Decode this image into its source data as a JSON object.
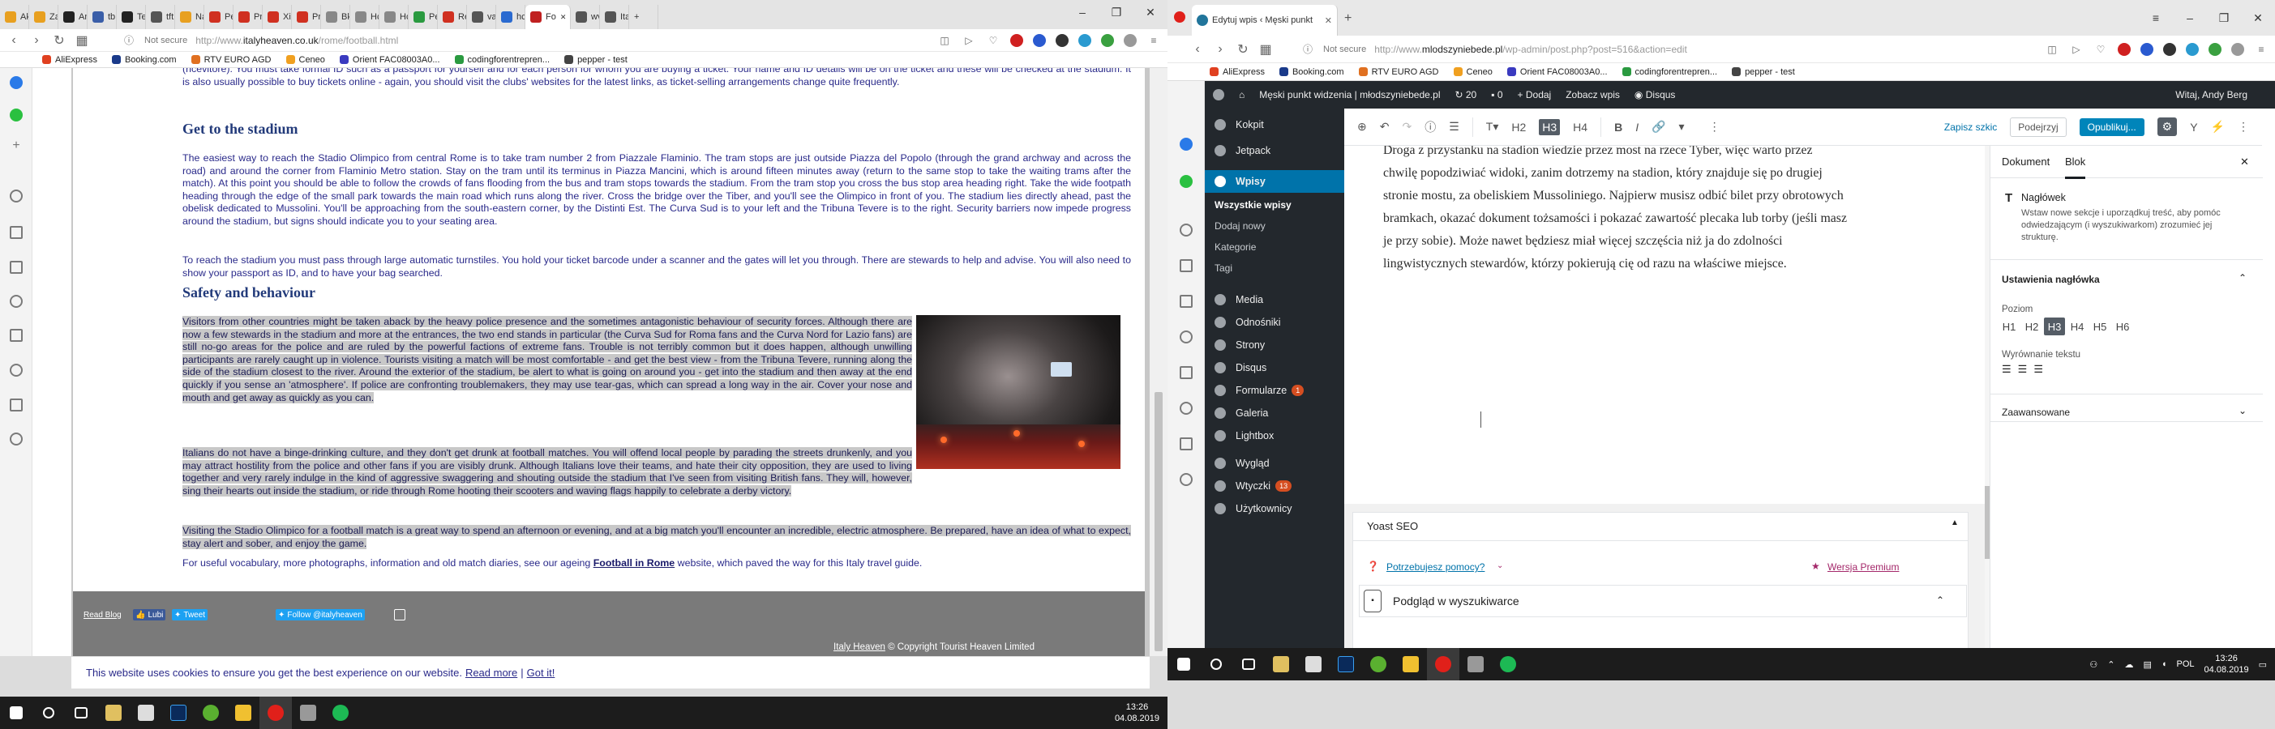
{
  "left_browser": {
    "tabs": [
      {
        "label": "Ak",
        "color": "#e8a020"
      },
      {
        "label": "Za",
        "color": "#e8a020"
      },
      {
        "label": "An",
        "color": "#222222"
      },
      {
        "label": "tb",
        "color": "#3a5ea8"
      },
      {
        "label": "Te",
        "color": "#222222"
      },
      {
        "label": "tft",
        "color": "#555555"
      },
      {
        "label": "Na",
        "color": "#e8a020"
      },
      {
        "label": "Pe",
        "color": "#d03020"
      },
      {
        "label": "Pr",
        "color": "#d03020"
      },
      {
        "label": "Xi",
        "color": "#d03020"
      },
      {
        "label": "Pr",
        "color": "#d03020"
      },
      {
        "label": "Bk",
        "color": "#888888"
      },
      {
        "label": "Hc",
        "color": "#888888"
      },
      {
        "label": "Hc",
        "color": "#888888"
      },
      {
        "label": "Pe",
        "color": "#2a9a40"
      },
      {
        "label": "Re",
        "color": "#d03020"
      },
      {
        "label": "va",
        "color": "#555555"
      },
      {
        "label": "hc",
        "color": "#2a6ad0"
      },
      {
        "label": "Fo",
        "color": "#c02020"
      },
      {
        "label": "wv",
        "color": "#555555"
      },
      {
        "label": "Ita",
        "color": "#555555"
      }
    ],
    "active_tab": 18,
    "url_prefix": "http://www.",
    "url_domain": "italyheaven.co.uk",
    "url_path": "/rome/football.html",
    "not_secure": "Not secure",
    "bookmarks": [
      "AliExpress",
      "Booking.com",
      "RTV EURO AGD",
      "Ceneo",
      "Orient FAC08003A0...",
      "codingforentrepren...",
      "pepper - test"
    ]
  },
  "article": {
    "p_tickets": "(ricevitore). You must take formal ID such as a passport for yourself and for each person for whom you are buying a ticket. Your name and ID details will be on the ticket and these will be checked at the stadium. It is also usually possible to buy tickets online - again, you should visit the clubs' websites for the latest links, as ticket-selling arrangements change quite frequently.",
    "h_get": "Get to the stadium",
    "p_get1": "The easiest way to reach the Stadio Olimpico from central Rome is to take tram number 2 from Piazzale Flaminio. The tram stops are just outside Piazza del Popolo (through the grand archway and across the road) and around the corner from Flaminio Metro station. Stay on the tram until its terminus in Piazza Mancini, which is around fifteen minutes away (return to the same stop to take the waiting trams after the match). At this point you should be able to follow the crowds of fans flooding from the bus and tram stops towards the stadium. From the tram stop you cross the bus stop area heading right. Take the wide footpath heading through the edge of the small park towards the main road which runs along the river. Cross the bridge over the Tiber, and you'll see the Olimpico in front of you. The stadium lies directly ahead, past the obelisk dedicated to Mussolini. You'll be approaching from the south-eastern corner, by the Distinti Est. The Curva Sud is to your left and the Tribuna Tevere is to the right. Security barriers now impede progress around the stadium, but signs should indicate you to your seating area.",
    "p_get2": "To reach the stadium you must pass through large automatic turnstiles. You hold your ticket barcode under a scanner and the gates will let you through. There are stewards to help and advise. You will also need to show your passport as ID, and to have your bag searched.",
    "h_safety": "Safety and behaviour",
    "p_safety1": "Visitors from other countries might be taken aback by the heavy police presence and the sometimes antagonistic behaviour of security forces. Although there are now a few stewards in the stadium and more at the entrances, the two end stands in particular (the Curva Sud for Roma fans and the Curva Nord for Lazio fans) are still no-go areas for the police and are ruled by the powerful factions of extreme fans. Trouble is not terribly common but it does happen, although unwilling participants are rarely caught up in violence. Tourists visiting a match will be most comfortable - and get the best view - from the Tribuna Tevere, running along the side of the stadium closest to the river. Around the exterior of the stadium, be alert to what is going on around you - get into the stadium and then away at the end quickly if you sense an 'atmosphere'. If police are confronting troublemakers, they may use tear-gas, which can spread a long way in the air. Cover your nose and mouth and get away as quickly as you can.",
    "p_safety2": "Italians do not have a binge-drinking culture, and they don't get drunk at football matches. You will offend local people by parading the streets drunkenly, and you may attract hostility from the police and other fans if you are visibly drunk. Although Italians love their teams, and hate their city opposition, they are used to living together and very rarely indulge in the kind of aggressive swaggering and shouting outside the stadium that I've seen from visiting British fans. They will, however, sing their hearts out inside the stadium, or ride through Rome hooting their scooters and waving flags happily to celebrate a derby victory.",
    "p_safety3": "Visiting the Stadio Olimpico for a football match is a great way to spend an afternoon or evening, and at a big match you'll encounter an incredible, electric atmosphere. Be prepared, have an idea of what to expect, stay alert and sober, and enjoy the game.",
    "p_useful_pre": "For useful vocabulary, more photographs, information and old match diaries, see our ageing ",
    "p_useful_link": "Football in Rome",
    "p_useful_post": " website, which paved the way for this Italy travel guide."
  },
  "footer": {
    "read_blog": "Read Blog",
    "like": "Lubi",
    "tweet": "Tweet",
    "follow": "Follow @italyheaven",
    "brand_link": "Italy Heaven",
    "copyright": " © Copyright Tourist Heaven Limited"
  },
  "cookie": {
    "text": "This website uses cookies to ensure you get the best experience on our website.",
    "read_more": "Read more",
    "sep": "|",
    "got_it": "Got it!"
  },
  "left_taskbar": {
    "time": "13:26",
    "date": "04.08.2019"
  },
  "right_browser": {
    "tab_title": "Edytuj wpis ‹ Męski punkt",
    "not_secure": "Not secure",
    "url_prefix": "http://www.",
    "url_domain": "mlodszyniebede.pl",
    "url_path": "/wp-admin/post.php?post=516&action=edit",
    "bookmarks": [
      "AliExpress",
      "Booking.com",
      "RTV EURO AGD",
      "Ceneo",
      "Orient FAC08003A0...",
      "codingforentrepren...",
      "pepper - test"
    ]
  },
  "wp_admin_bar": {
    "site": "Męski punkt widzenia | młodszyniebede.pl",
    "updates": "20",
    "comments": "0",
    "add": "Dodaj",
    "view": "Zobacz wpis",
    "disqus": "Disqus",
    "greeting": "Witaj, Andy Berg"
  },
  "wp_menu": {
    "kokpit": "Kokpit",
    "jetpack": "Jetpack",
    "wpisy": "Wpisy",
    "sub_all": "Wszystkie wpisy",
    "sub_add": "Dodaj nowy",
    "sub_cat": "Kategorie",
    "sub_tags": "Tagi",
    "media": "Media",
    "links": "Odnośniki",
    "pages": "Strony",
    "disqus": "Disqus",
    "forms": "Formularze",
    "forms_badge": "1",
    "gallery": "Galeria",
    "lightbox": "Lightbox",
    "look": "Wygląd",
    "plugins": "Wtyczki",
    "plugins_badge": "13",
    "users": "Użytkownicy"
  },
  "editor_toolbar": {
    "save_draft": "Zapisz szkic",
    "preview": "Podejrzyj",
    "publish": "Opublikuj..."
  },
  "editor_text": "Droga z przystanku na stadion wiedzie przez most na rzece Tyber, więc warto przez chwilę popodziwiać widoki, zanim dotrzemy na stadion, który znajduje się po drugiej stronie mostu, za obeliskiem Mussoliniego. Najpierw musisz odbić bilet przy obrotowych bramkach, okazać dokument tożsamości i pokazać zawartość plecaka lub torby (jeśli masz je przy sobie). Może nawet będziesz miał więcej szczęścia niż ja do zdolności lingwistycznych stewardów, którzy pokierują cię od razu na właściwe miejsce.",
  "sidebar": {
    "tab_doc": "Dokument",
    "tab_block": "Blok",
    "block_name": "Nagłówek",
    "block_desc": "Wstaw nowe sekcje i uporządkuj treść, aby pomóc odwiedzającym (i wyszukiwarkom) zrozumieć jej strukturę.",
    "settings_title": "Ustawienia nagłówka",
    "level_label": "Poziom",
    "levels": [
      "H1",
      "H2",
      "H3",
      "H4",
      "H5",
      "H6"
    ],
    "selected_level": "H3",
    "align_label": "Wyrównanie tekstu",
    "advanced": "Zaawansowane"
  },
  "yoast": {
    "title": "Yoast SEO",
    "help": "Potrzebujesz pomocy?",
    "premium": "Wersja Premium",
    "snippet": "Podgląd w wyszukiwarce"
  },
  "right_taskbar": {
    "lang": "POL",
    "time": "13:26",
    "date": "04.08.2019"
  },
  "colors": {
    "wp_dark": "#23282d",
    "wp_blue": "#0073aa",
    "site_text": "#2a2a8a"
  }
}
